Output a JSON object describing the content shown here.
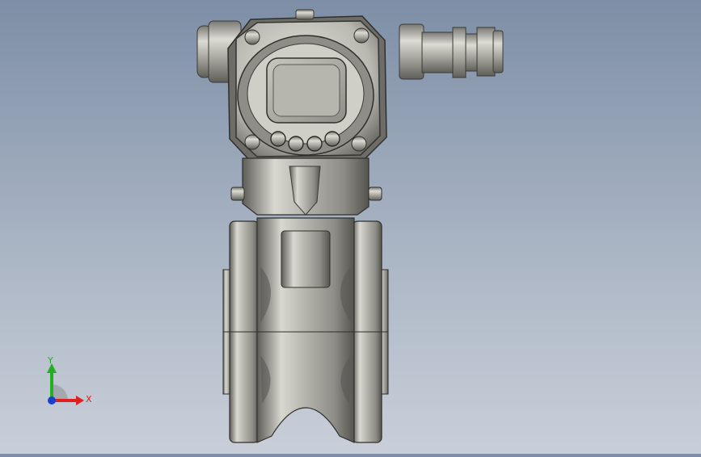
{
  "viewport": {
    "background_top": "#7d8ea6",
    "background_bottom": "#c9cfd9",
    "model": "vortex-flowmeter-front-view"
  },
  "triad": {
    "x_label": "X",
    "y_label": "Y",
    "x_color": "#e02020",
    "y_color": "#20b020",
    "origin_color": "#1a3fd0"
  }
}
